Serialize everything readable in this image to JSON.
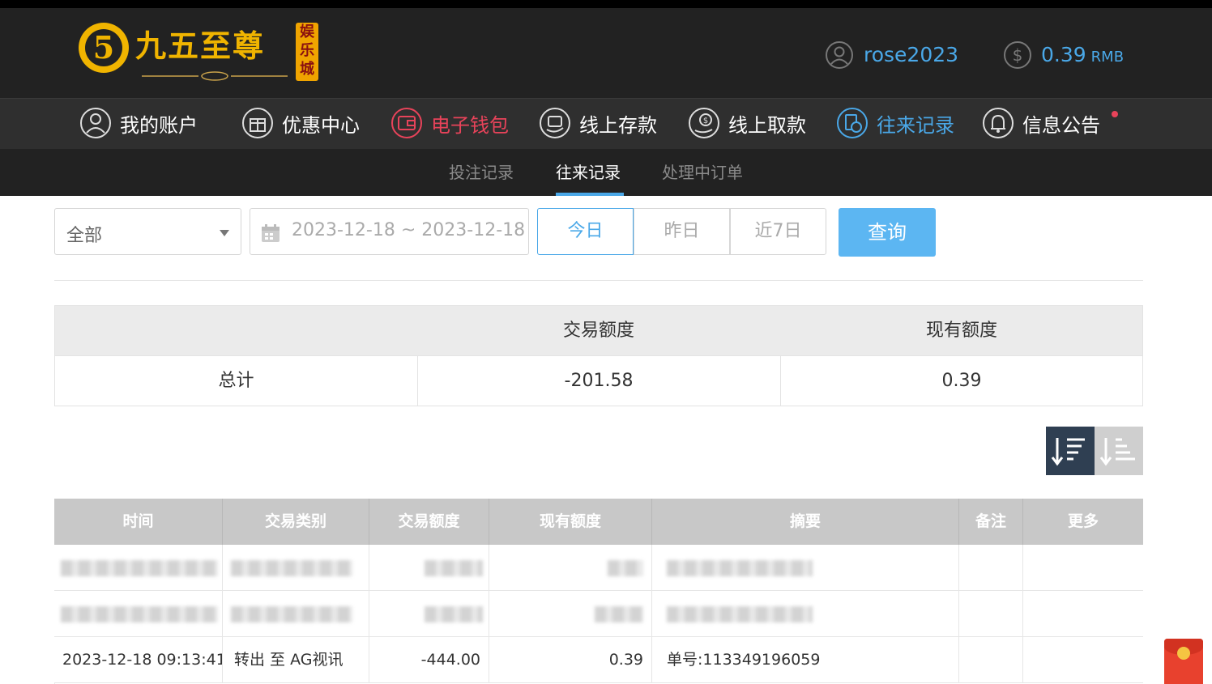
{
  "brand": {
    "name": "九五至尊",
    "tag": "娱乐城"
  },
  "user": {
    "username": "rose2023",
    "balance": "0.39",
    "currency": "RMB"
  },
  "nav": {
    "items": [
      {
        "label": "我的账户"
      },
      {
        "label": "优惠中心"
      },
      {
        "label": "电子钱包"
      },
      {
        "label": "线上存款"
      },
      {
        "label": "线上取款"
      },
      {
        "label": "往来记录"
      },
      {
        "label": "信息公告"
      }
    ]
  },
  "subnav": {
    "tabs": [
      {
        "label": "投注记录"
      },
      {
        "label": "往来记录"
      },
      {
        "label": "处理中订单"
      }
    ]
  },
  "filter": {
    "type_selected": "全部",
    "date_range": "2023-12-18 ~ 2023-12-18",
    "quick": [
      {
        "label": "今日"
      },
      {
        "label": "昨日"
      },
      {
        "label": "近7日"
      }
    ],
    "search_label": "查询"
  },
  "summary": {
    "headers": [
      "",
      "交易额度",
      "现有额度"
    ],
    "row": {
      "label": "总计",
      "amount": "-201.58",
      "balance": "0.39"
    }
  },
  "table": {
    "headers": [
      "时间",
      "交易类别",
      "交易额度",
      "现有额度",
      "摘要",
      "备注",
      "更多"
    ],
    "visible_row": {
      "time": "2023-12-18 09:13:41",
      "type": "转出 至 AG视讯",
      "amount": "-444.00",
      "balance": "0.39",
      "summary": "单号:113349196059",
      "note": "",
      "more": ""
    }
  },
  "colors": {
    "accent": "#4aa8e8",
    "alert": "#e8435a",
    "gold": "#f0b400"
  }
}
